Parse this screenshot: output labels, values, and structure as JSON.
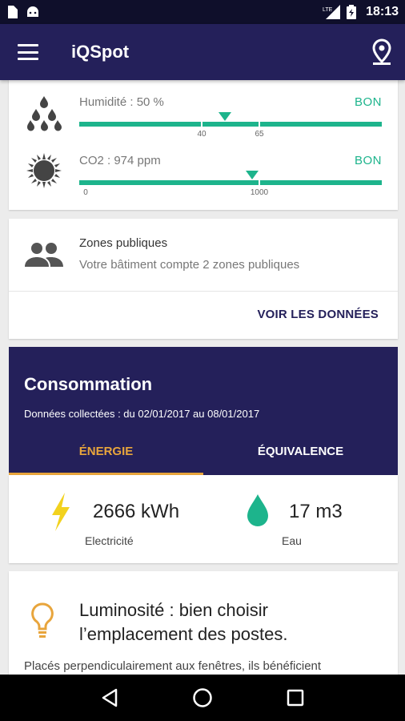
{
  "status_bar": {
    "time": "18:13",
    "network": "LTE"
  },
  "app_bar": {
    "title": "iQSpot"
  },
  "sensors": [
    {
      "label": "Humidité : 50 %",
      "status": "BON",
      "tick_labels": [
        "40",
        "65"
      ],
      "level": 50
    },
    {
      "label": "CO2 : 974 ppm",
      "status": "BON",
      "tick_labels": [
        "0",
        "1000"
      ],
      "level": 974
    }
  ],
  "zones": {
    "title": "Zones publiques",
    "subtitle": "Votre bâtiment compte 2 zones publiques",
    "button": "VOIR LES DONNÉES"
  },
  "consommation": {
    "title": "Consommation",
    "subtitle": "Données collectées : du 02/01/2017 au 08/01/2017",
    "tabs": [
      {
        "label": "ÉNERGIE",
        "active": true
      },
      {
        "label": "ÉQUIVALENCE",
        "active": false
      }
    ],
    "metrics": [
      {
        "value": "2666 kWh",
        "label": "Electricité",
        "icon": "lightning-icon"
      },
      {
        "value": "17 m3",
        "label": "Eau",
        "icon": "water-drop-icon"
      }
    ]
  },
  "tip": {
    "title": "Luminosité : bien choisir l’emplacement des postes.",
    "text": "Placés perpendiculairement aux fenêtres, ils bénéficient"
  },
  "colors": {
    "primary": "#24205a",
    "accent": "#e8a53c",
    "good": "#1db48c",
    "lightning": "#f2d21e",
    "water": "#1db48c"
  }
}
